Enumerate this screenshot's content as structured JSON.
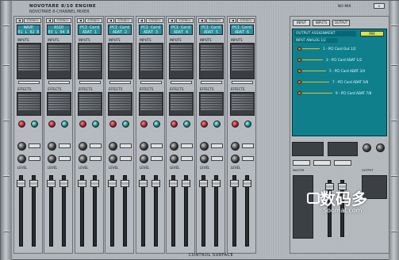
{
  "window": {
    "brand_line1": "NOVOTARE 8/10 ENGINE",
    "brand_line2": "NOVOTARE 8-CHANNEL MIXER",
    "footer": "CONTROL SURFACE",
    "top_right_label": "NO MIX"
  },
  "channels": [
    {
      "nav": "STEREO",
      "lcd1": "WAVE",
      "lcd2": "01 L  02 R",
      "inputs_label": "INPUTS",
      "fx_label": "EFFECTS",
      "level_label": "LEVEL"
    },
    {
      "nav": "STEREO",
      "lcd1": "ASIO",
      "lcd2": "03 L  04 R",
      "inputs_label": "INPUTS",
      "fx_label": "EFFECTS",
      "level_label": "LEVEL"
    },
    {
      "nav": "STEREO",
      "lcd1": "PCI Card",
      "lcd2": "ADAT 1",
      "inputs_label": "INPUTS",
      "fx_label": "EFFECTS",
      "level_label": "LEVEL"
    },
    {
      "nav": "STEREO",
      "lcd1": "PCI Card",
      "lcd2": "ADAT 2",
      "inputs_label": "INPUTS",
      "fx_label": "EFFECTS",
      "level_label": "LEVEL"
    },
    {
      "nav": "STEREO",
      "lcd1": "PCI Card",
      "lcd2": "ADAT 3",
      "inputs_label": "INPUTS",
      "fx_label": "EFFECTS",
      "level_label": "LEVEL"
    },
    {
      "nav": "STEREO",
      "lcd1": "PCI Card",
      "lcd2": "ADAT 4",
      "inputs_label": "INPUTS",
      "fx_label": "EFFECTS",
      "level_label": "LEVEL"
    },
    {
      "nav": "STEREO",
      "lcd1": "PCI Card",
      "lcd2": "ADAT 5",
      "inputs_label": "INPUTS",
      "fx_label": "EFFECTS",
      "level_label": "LEVEL"
    },
    {
      "nav": "STEREO",
      "lcd1": "PCI Card",
      "lcd2": "ADAT 6",
      "inputs_label": "INPUTS",
      "fx_label": "EFFECTS",
      "level_label": "LEVEL"
    }
  ],
  "right": {
    "tabs": [
      "INPUT",
      "INPUTS",
      "OUTPUT"
    ],
    "router_header": "OUTPUT ASSIGNMENT",
    "router_mode": "MIX",
    "router_source": "INPUT ANALOG 1/2",
    "routes": [
      {
        "label": "1 - PCI Card Out 1/2"
      },
      {
        "label": "3 - PCI Card ADAT 1/2"
      },
      {
        "label": "5 - PCI Card ADAT 3/4"
      },
      {
        "label": "7 - PCI Card ADAT 5/6"
      },
      {
        "label": "9 - PCI Card ADAT 7/8"
      }
    ],
    "meter_label": "MASTER",
    "out_label": "OUTPUT",
    "level_label": "LEVEL"
  },
  "watermark": {
    "big": "数码多",
    "small": "Soomal.com"
  }
}
